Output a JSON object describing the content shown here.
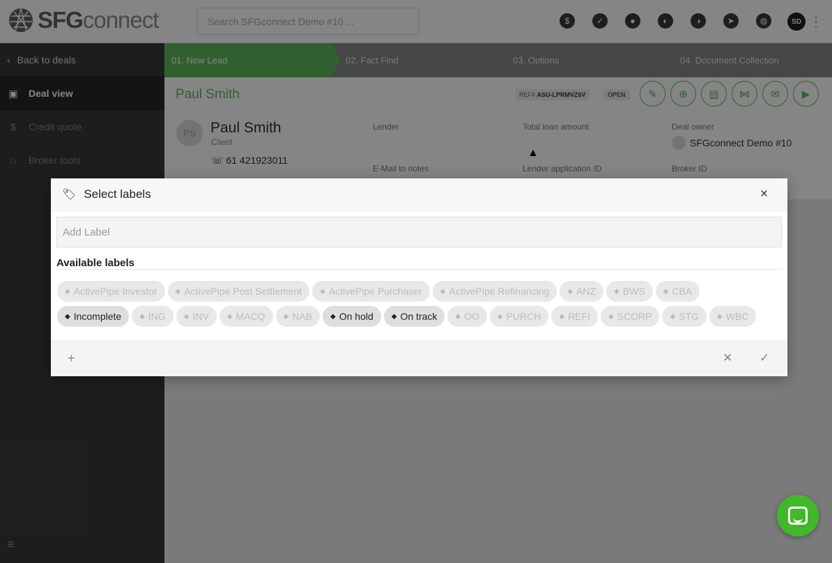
{
  "app": {
    "logo_brand": "SFG",
    "logo_suffix": "connect"
  },
  "search": {
    "placeholder": "Search SFGconnect Demo #10 ..."
  },
  "topbar": {
    "icons": [
      "dollar-icon",
      "check-circle-icon",
      "user-circle-icon",
      "contrast-icon",
      "moon-icon",
      "compass-icon",
      "globe-icon"
    ],
    "avatar_initials": "SD"
  },
  "sidebar": {
    "back": "Back to deals",
    "items": [
      {
        "label": "Deal view",
        "icon": "briefcase-icon",
        "active": true
      },
      {
        "label": "Credit quote",
        "icon": "dollar-icon",
        "active": false
      },
      {
        "label": "Broker tools",
        "icon": "bank-icon",
        "active": false
      }
    ]
  },
  "stepper": [
    "01. New Lead",
    "02. Fact Find",
    "03. Options",
    "04. Document Collection"
  ],
  "deal": {
    "title": "Paul Smith",
    "ref_label": "REF#",
    "ref_value": "ASU-LPRMVZ6V",
    "status": "OPEN",
    "client_initials": "PS",
    "client_name": "Paul Smith",
    "client_role": "Client",
    "phone": "61 421923011",
    "fields": {
      "lender": "Lender",
      "total_loan": "Total loan amount",
      "deal_owner": "Deal owner",
      "email_notes": "E-Mail to notes",
      "lender_app_id": "Lender application ID",
      "broker_id": "Broker ID"
    },
    "owner_name": "SFGconnect Demo #10"
  },
  "modal": {
    "title": "Select labels",
    "add_placeholder": "Add Label",
    "available_heading": "Available labels",
    "rows": [
      [
        {
          "label": "ActivePipe Investor",
          "selected": false
        },
        {
          "label": "ActivePipe Post Settlement",
          "selected": false
        },
        {
          "label": "ActivePipe Purchaser",
          "selected": false
        },
        {
          "label": "ActivePipe Refinancing",
          "selected": false
        },
        {
          "label": "ANZ",
          "selected": false
        },
        {
          "label": "BWS",
          "selected": false
        },
        {
          "label": "CBA",
          "selected": false
        }
      ],
      [
        {
          "label": "Incomplete",
          "selected": true
        },
        {
          "label": "ING",
          "selected": false
        },
        {
          "label": "INV",
          "selected": false
        },
        {
          "label": "MACQ",
          "selected": false
        },
        {
          "label": "NAB",
          "selected": false
        },
        {
          "label": "On hold",
          "selected": true
        },
        {
          "label": "On track",
          "selected": true
        },
        {
          "label": "OO",
          "selected": false
        },
        {
          "label": "PURCH",
          "selected": false
        },
        {
          "label": "REFI",
          "selected": false
        },
        {
          "label": "SCORP",
          "selected": false
        },
        {
          "label": "STG",
          "selected": false
        },
        {
          "label": "WBC",
          "selected": false
        }
      ]
    ]
  },
  "colors": {
    "accent": "#5cb85c",
    "sidebar": "#37393d",
    "chat": "#42b72a"
  }
}
